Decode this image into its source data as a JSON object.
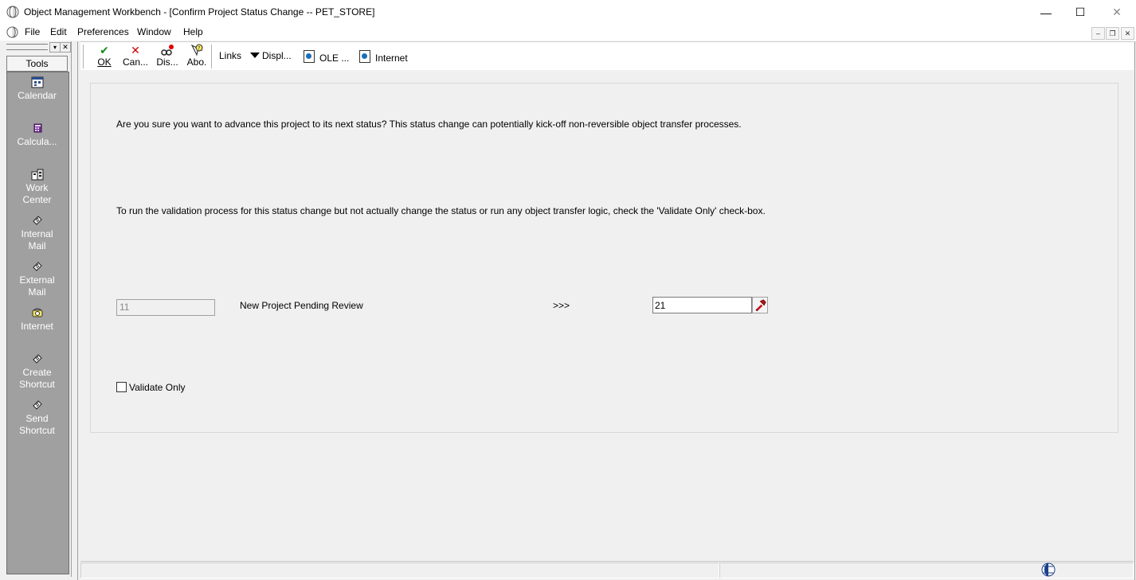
{
  "window": {
    "title": "Object Management Workbench - [Confirm Project Status Change -- PET_STORE]",
    "controls": {
      "minimize": "—",
      "maximize": "☐",
      "close": "✕"
    }
  },
  "menu": {
    "file": "File",
    "edit": "Edit",
    "preferences": "Preferences",
    "window": "Window",
    "help": "Help",
    "mdi": {
      "minimize": "–",
      "restore": "❐",
      "close": "✕"
    }
  },
  "tools": {
    "header": "Tools",
    "items": [
      {
        "label1": "Calendar",
        "label2": "",
        "icon": "calendar-icon"
      },
      {
        "label1": "Calcula...",
        "label2": "",
        "icon": "calculator-icon"
      },
      {
        "label1": "Work",
        "label2": "Center",
        "icon": "work-center-icon"
      },
      {
        "label1": "Internal",
        "label2": "Mail",
        "icon": "internal-mail-icon"
      },
      {
        "label1": "External",
        "label2": "Mail",
        "icon": "external-mail-icon"
      },
      {
        "label1": "Internet",
        "label2": "",
        "icon": "internet-icon"
      },
      {
        "label1": "Create",
        "label2": "Shortcut",
        "icon": "create-shortcut-icon"
      },
      {
        "label1": "Send",
        "label2": "Shortcut",
        "icon": "send-shortcut-icon"
      }
    ]
  },
  "toolbar": {
    "ok": "OK",
    "cancel": "Can...",
    "display": "Dis...",
    "about": "Abo.",
    "links": "Links",
    "displ": "Displ...",
    "ole": "OLE ...",
    "internet": "Internet"
  },
  "form": {
    "message1": "Are you sure you want to advance this project to its next status?  This status change can potentially kick-off non-reversible object transfer processes.",
    "message2": "To run the validation process for this status change but not actually change the status or run any object transfer logic, check the 'Validate Only' check-box.",
    "current_status": "11",
    "current_status_desc": "New Project Pending Review",
    "arrow": ">>>",
    "next_status": "21",
    "validate_only_label": "Validate Only",
    "validate_only_checked": false
  },
  "colors": {
    "tools_bg": "#a0a0a0",
    "ok_green": "#1a8a1a",
    "cancel_red": "#d00000"
  }
}
